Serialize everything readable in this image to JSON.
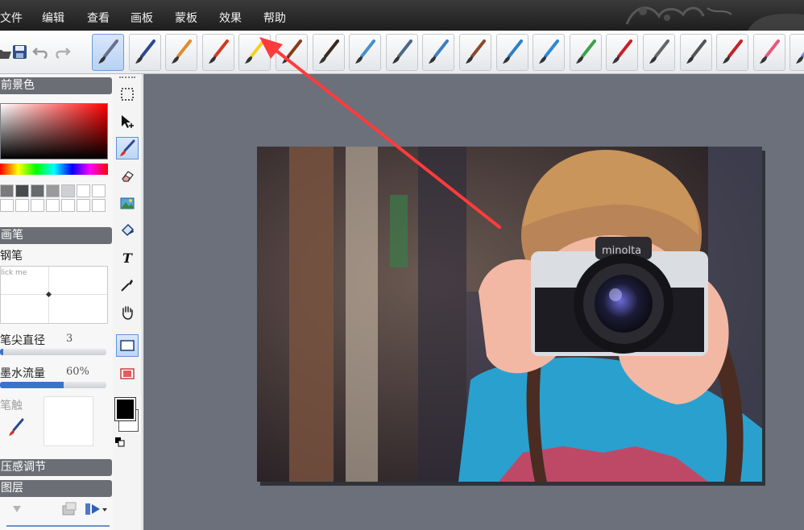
{
  "menu": {
    "items": [
      "文件",
      "编辑",
      "查看",
      "画板",
      "蒙板",
      "效果",
      "帮助"
    ]
  },
  "toolbar": {
    "quick_icons": [
      "open-icon",
      "save-icon",
      "undo-icon",
      "redo-icon"
    ],
    "brushes": [
      {
        "name": "calligraphy-pen",
        "color": "#6b6f8a",
        "selected": true
      },
      {
        "name": "ink-pen",
        "color": "#2b4a8f"
      },
      {
        "name": "pencil",
        "color": "#e08a2c"
      },
      {
        "name": "crayon",
        "color": "#d13a20"
      },
      {
        "name": "highlighter",
        "color": "#f1d21f"
      },
      {
        "name": "paint-brush",
        "color": "#8a3a1a"
      },
      {
        "name": "oil-brush",
        "color": "#3b2a1a"
      },
      {
        "name": "air-brush",
        "color": "#4a90c8"
      },
      {
        "name": "spray-can",
        "color": "#4a6a8a"
      },
      {
        "name": "fan-brush",
        "color": "#3d7fc0"
      },
      {
        "name": "wet-brush",
        "color": "#8a4a2a"
      },
      {
        "name": "watercolor-brush",
        "color": "#2f7fc5"
      },
      {
        "name": "blur-tool",
        "color": "#2e88d6"
      },
      {
        "name": "grass-brush",
        "color": "#3aa14a"
      },
      {
        "name": "flower-brush",
        "color": "#c8202a"
      },
      {
        "name": "texture-brush-1",
        "color": "#666666"
      },
      {
        "name": "texture-brush-2",
        "color": "#555555"
      },
      {
        "name": "stamp-tool",
        "color": "#c42424"
      },
      {
        "name": "eraser-pink",
        "color": "#e8577a"
      },
      {
        "name": "eraser-blue",
        "color": "#7a86c8"
      }
    ]
  },
  "panel": {
    "foreground_header": "前景色",
    "brush_header": "画笔",
    "brush_name": "钢笔",
    "click_me": "lick me",
    "tip_diameter_label": "笔尖直径",
    "tip_diameter_value": "3",
    "tip_diameter_fraction": 0.03,
    "ink_flow_label": "墨水流量",
    "ink_flow_value": "60%",
    "ink_flow_fraction": 0.6,
    "brush_touch_label": "笔触",
    "pressure_header": "压感调节",
    "layers_header": "图层"
  },
  "colors": {
    "foreground": "#000000",
    "background": "#ffffff",
    "accent": "#ff3b3b"
  },
  "tools": [
    "select-rect-icon",
    "move-icon",
    "brush-tool-icon",
    "eraser-tool-icon",
    "image-tool-icon",
    "fill-tool-icon",
    "text-tool-icon",
    "eyedropper-icon",
    "hand-icon",
    "rect-shape-icon",
    "fill-rect-icon"
  ]
}
